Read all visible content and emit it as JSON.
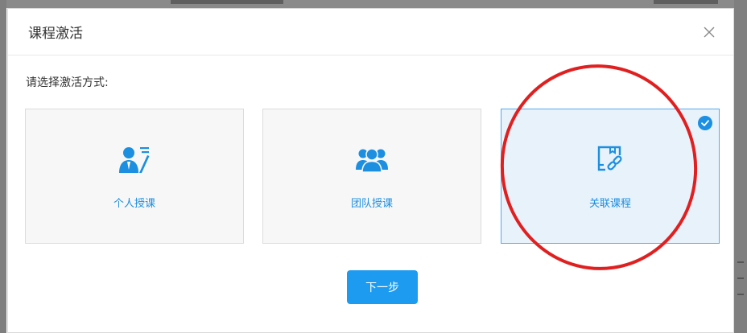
{
  "dialog": {
    "title": "课程激活",
    "close_icon": "close-icon"
  },
  "prompt": "请选择激活方式:",
  "options": [
    {
      "label": "个人授课",
      "icon": "person-teacher-icon",
      "selected": false
    },
    {
      "label": "团队授课",
      "icon": "team-icon",
      "selected": false
    },
    {
      "label": "关联课程",
      "icon": "link-course-icon",
      "selected": true
    }
  ],
  "next_button": "下一步",
  "colors": {
    "accent": "#1c9bf0",
    "selected_bg": "#e8f2fb",
    "selected_border": "#5aa8e8",
    "icon_blue": "#1c8fe0",
    "annotation_red": "#e02020"
  }
}
